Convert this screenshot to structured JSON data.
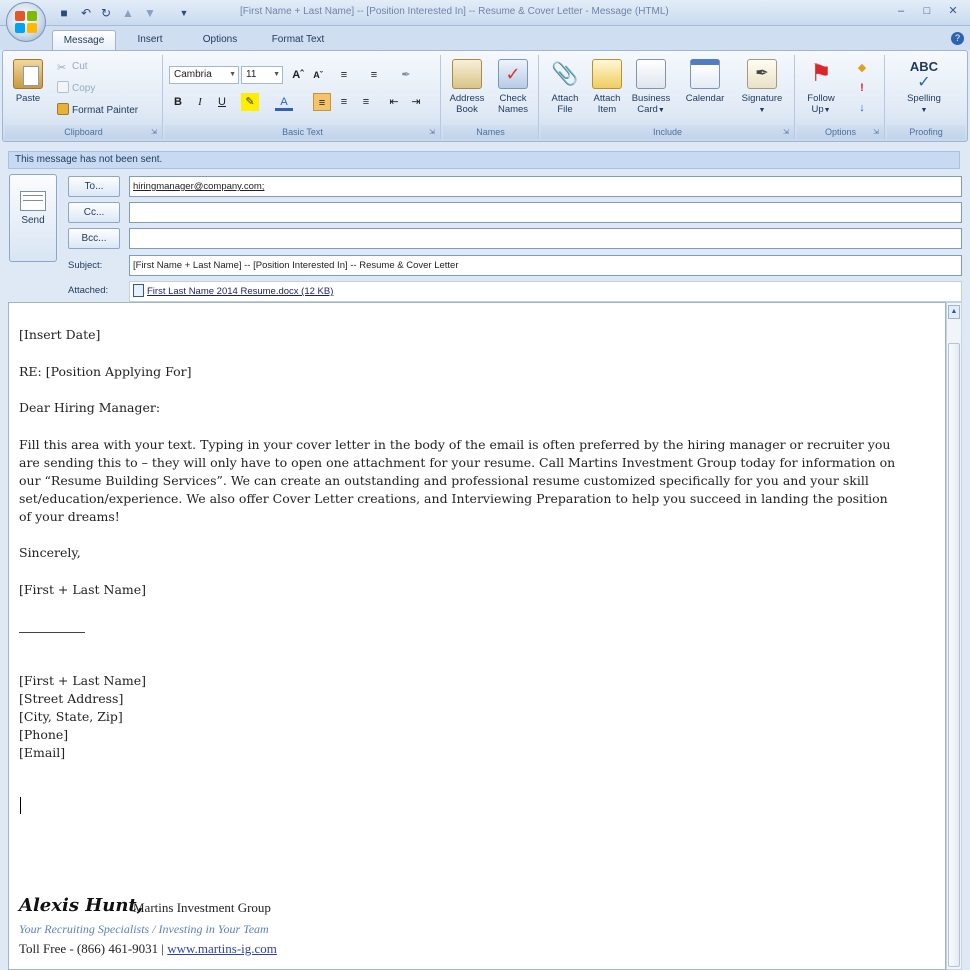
{
  "window": {
    "title": "[First Name + Last Name] -- [Position Interested In] -- Resume & Cover Letter - Message (HTML)"
  },
  "tabs": [
    "Message",
    "Insert",
    "Options",
    "Format Text"
  ],
  "ribbon": {
    "clipboard": {
      "label": "Clipboard",
      "paste": "Paste",
      "cut": "Cut",
      "copy": "Copy",
      "format_painter": "Format Painter"
    },
    "basic_text": {
      "label": "Basic Text",
      "font": "Cambria",
      "size": "11"
    },
    "names": {
      "label": "Names",
      "address_book": [
        "Address",
        "Book"
      ],
      "check_names": [
        "Check",
        "Names"
      ]
    },
    "include": {
      "label": "Include",
      "attach_file": [
        "Attach",
        "File"
      ],
      "attach_item": [
        "Attach",
        "Item"
      ],
      "business_card": [
        "Business",
        "Card"
      ],
      "calendar": "Calendar",
      "signature": "Signature"
    },
    "options": {
      "label": "Options",
      "follow_up": [
        "Follow",
        "Up"
      ]
    },
    "proofing": {
      "label": "Proofing",
      "spelling": "Spelling",
      "spelling_icon": "ABC"
    }
  },
  "infobar": "This message has not been sent.",
  "header": {
    "send": "Send",
    "to_button": "To...",
    "cc_button": "Cc...",
    "bcc_button": "Bcc...",
    "to_value": "hiringmanager@company.com;",
    "cc_value": "",
    "bcc_value": "",
    "subject_label": "Subject:",
    "subject_value": "[First Name + Last Name] -- [Position Interested In] -- Resume & Cover Letter",
    "attached_label": "Attached:",
    "attachment": "First Last Name 2014 Resume.docx (12 KB)"
  },
  "body": {
    "date": "[Insert Date]",
    "re": "RE: [Position Applying For]",
    "greeting": "Dear Hiring Manager:",
    "paragraph": "Fill this area with your text. Typing in your cover letter in the body of the email is often preferred by the hiring manager or recruiter you are sending this to – they will only have to open one attachment for your resume. Call Martins Investment Group today for information on our “Resume Building Services”. We can create an outstanding and professional resume customized specifically for you and your skill set/education/experience. We also offer Cover Letter creations, and Interviewing Preparation to help you succeed in landing the position of your dreams!",
    "closing": "Sincerely,",
    "name": "[First + Last Name]",
    "address_block": [
      "[First + Last Name]",
      "[Street Address]",
      "[City, State, Zip]",
      "[Phone]",
      "[Email]"
    ]
  },
  "signature": {
    "name": "Alexis Hunt,",
    "company": "Martins Investment Group",
    "tagline": "Your Recruiting Specialists / Investing in Your Team",
    "phone": "Toll Free - (866) 461-9031 | ",
    "website": "www.martins-ig.com"
  },
  "colors": {
    "ribbon_bg": "#dfe9f5",
    "accent_blue": "#2e63b0",
    "link": "#2b3fb8",
    "tagline": "#5b7fc2"
  }
}
